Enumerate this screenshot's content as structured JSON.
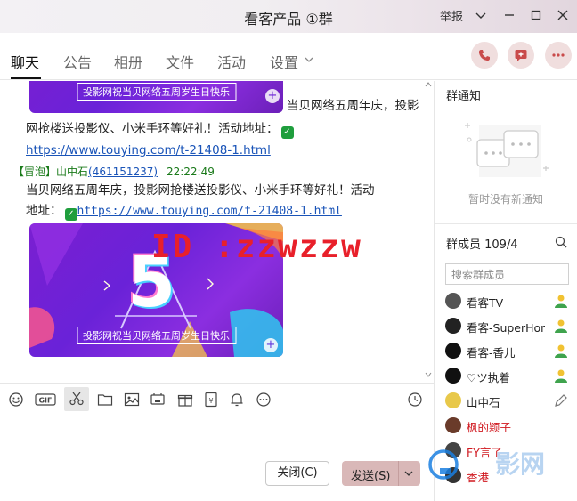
{
  "window": {
    "title": "看客产品 ①群",
    "report_label": "举报",
    "controls": [
      "minimize-icon",
      "maximize-icon",
      "close-icon"
    ]
  },
  "tabs": [
    {
      "label": "聊天",
      "active": true
    },
    {
      "label": "公告",
      "active": false
    },
    {
      "label": "相册",
      "active": false
    },
    {
      "label": "文件",
      "active": false
    },
    {
      "label": "活动",
      "active": false
    },
    {
      "label": "设置",
      "active": false
    }
  ],
  "chat": {
    "banner1_caption": "投影网祝当贝网络五周岁生日快乐",
    "msg1_line1": "当贝网络五周年庆，投影",
    "msg1_line2": "网抢楼送投影仪、小米手环等好礼！活动地址：",
    "msg1_link": "https://www.touying.com/t-21408-1.html",
    "msg2_tag": "【冒泡】",
    "msg2_sender": "山中石",
    "msg2_qq": "(461151237)",
    "msg2_time": "22:22:49",
    "msg2_line1": "当贝网络五周年庆，投影网抢楼送投影仪、小米手环等好礼！活动",
    "msg2_line2_prefix": "地址：",
    "msg2_link": "https://www.touying.com/t-21408-1.html",
    "banner2_caption": "投影网祝当贝网络五周岁生日快乐",
    "banner2_number": "5",
    "watermark": "ID :zzwzzw"
  },
  "input": {
    "close_label": "关闭(C)",
    "send_label": "发送(S)"
  },
  "right_panel": {
    "notice_title": "群通知",
    "notice_empty": "暂时没有新通知",
    "members_title": "群成员 109/4",
    "search_placeholder": "搜索群成员",
    "members": [
      {
        "name": "看客TV",
        "role": "admin",
        "name_color": "#222222"
      },
      {
        "name": "看客-SuperHon",
        "role": "admin",
        "name_color": "#222222"
      },
      {
        "name": "看客-香儿",
        "role": "admin",
        "name_color": "#222222"
      },
      {
        "name": "♡ツ执着",
        "role": "admin",
        "name_color": "#222222"
      },
      {
        "name": "山中石",
        "role": "edit",
        "name_color": "#222222"
      },
      {
        "name": "枫的颖子",
        "role": "",
        "name_color": "#d0181f"
      },
      {
        "name": "FY言了",
        "role": "",
        "name_color": "#d0181f"
      },
      {
        "name": "香港",
        "role": "",
        "name_color": "#d0181f"
      }
    ],
    "logo_text": "影网"
  },
  "colors": {
    "accent_red": "#c94b4b",
    "link_blue": "#1a54b8",
    "green_sender": "#1a7a1a",
    "send_button": "#d9b8b8"
  }
}
